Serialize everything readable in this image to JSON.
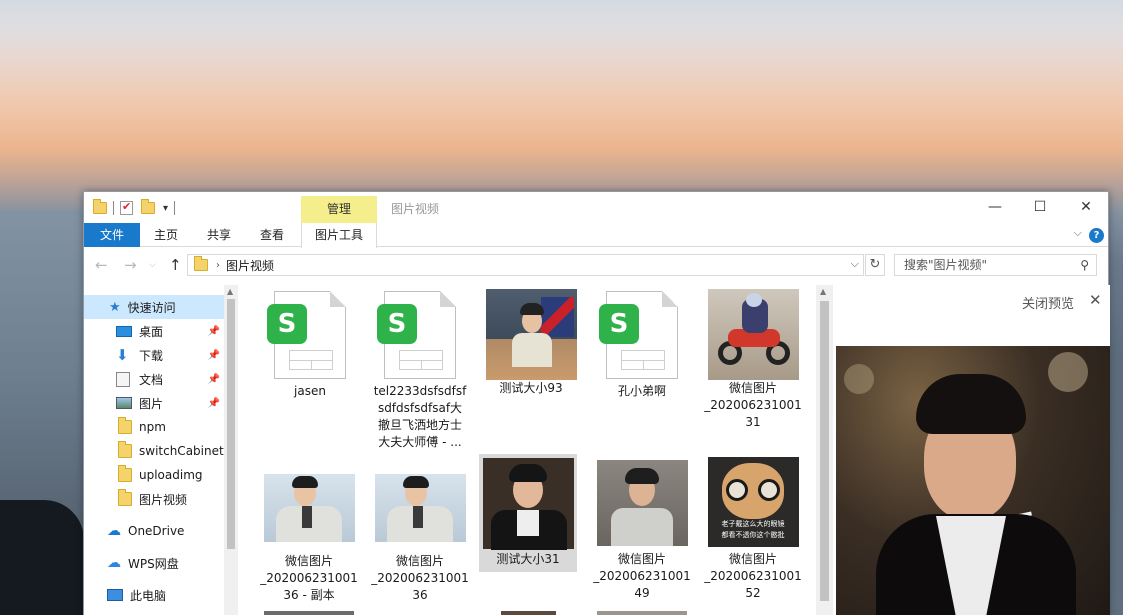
{
  "title_bar": {
    "manage_tab": "管理",
    "window_title": "图片视频",
    "minimize": "—",
    "maximize": "☐",
    "close": "✕"
  },
  "ribbon": {
    "tabs": [
      {
        "label": "文件"
      },
      {
        "label": "主页"
      },
      {
        "label": "共享"
      },
      {
        "label": "查看"
      },
      {
        "label": "图片工具"
      }
    ],
    "help": "?"
  },
  "navigation": {
    "back": "←",
    "forward": "→",
    "up": "↑",
    "path": "图片视频",
    "search_placeholder": "搜索\"图片视频\""
  },
  "sidebar": {
    "items": [
      {
        "label": "快速访问",
        "icon": "star-icon"
      },
      {
        "label": "桌面",
        "icon": "desktop-icon",
        "pinned": true
      },
      {
        "label": "下载",
        "icon": "download-icon",
        "pinned": true
      },
      {
        "label": "文档",
        "icon": "document-icon",
        "pinned": true
      },
      {
        "label": "图片",
        "icon": "picture-icon",
        "pinned": true
      },
      {
        "label": "npm",
        "icon": "folder-icon"
      },
      {
        "label": "switchCabinet",
        "icon": "folder-icon"
      },
      {
        "label": "uploadimg",
        "icon": "folder-icon"
      },
      {
        "label": "图片视频",
        "icon": "folder-icon"
      },
      {
        "label": "OneDrive",
        "icon": "cloud-icon"
      },
      {
        "label": "WPS网盘",
        "icon": "cloud-icon"
      },
      {
        "label": "此电脑",
        "icon": "computer-icon"
      }
    ]
  },
  "files": [
    {
      "name": "jasen",
      "type": "sheet"
    },
    {
      "name": "tel2233dsfsdfsfsdfdsfsdfsaf大撤旦飞洒地方士大夫大师傅 - ...",
      "type": "sheet"
    },
    {
      "name": "测试大小93",
      "type": "image"
    },
    {
      "name": "孔小弟啊",
      "type": "sheet"
    },
    {
      "name": "微信图片_20200623100131",
      "type": "image"
    },
    {
      "name": "微信图片_2020062310013 6 - 副本",
      "type": "image"
    },
    {
      "name": "微信图片_2020062310013 6",
      "type": "image"
    },
    {
      "name": "测试大小31",
      "type": "image",
      "selected": true
    },
    {
      "name": "微信图片_2020062310014 9",
      "type": "image"
    },
    {
      "name": "微信图片_2020062310015 2",
      "type": "image"
    }
  ],
  "file_labels": {
    "f1": "jasen",
    "f2a": "tel2233dsfsdfsf",
    "f2b": "sdfdsfsdfsaf大",
    "f2c": "撤旦飞洒地方士",
    "f2d": "大夫大师傅 - ...",
    "f3": "测试大小93",
    "f4": "孔小弟啊",
    "f5a": "微信图片",
    "f5b": "_202006231001",
    "f5c": "31",
    "f6a": "微信图片",
    "f6b": "_202006231001",
    "f6c": "36 - 副本",
    "f7a": "微信图片",
    "f7b": "_202006231001",
    "f7c": "36",
    "f8": "测试大小31",
    "f9a": "微信图片",
    "f9b": "_202006231001",
    "f9c": "49",
    "f10a": "微信图片",
    "f10b": "_202006231001",
    "f10c": "52"
  },
  "meme_text": {
    "line1": "老子戴这么大的眼镜",
    "line2": "都看不透你这个憨批"
  },
  "preview": {
    "close_label": "关闭预览"
  }
}
